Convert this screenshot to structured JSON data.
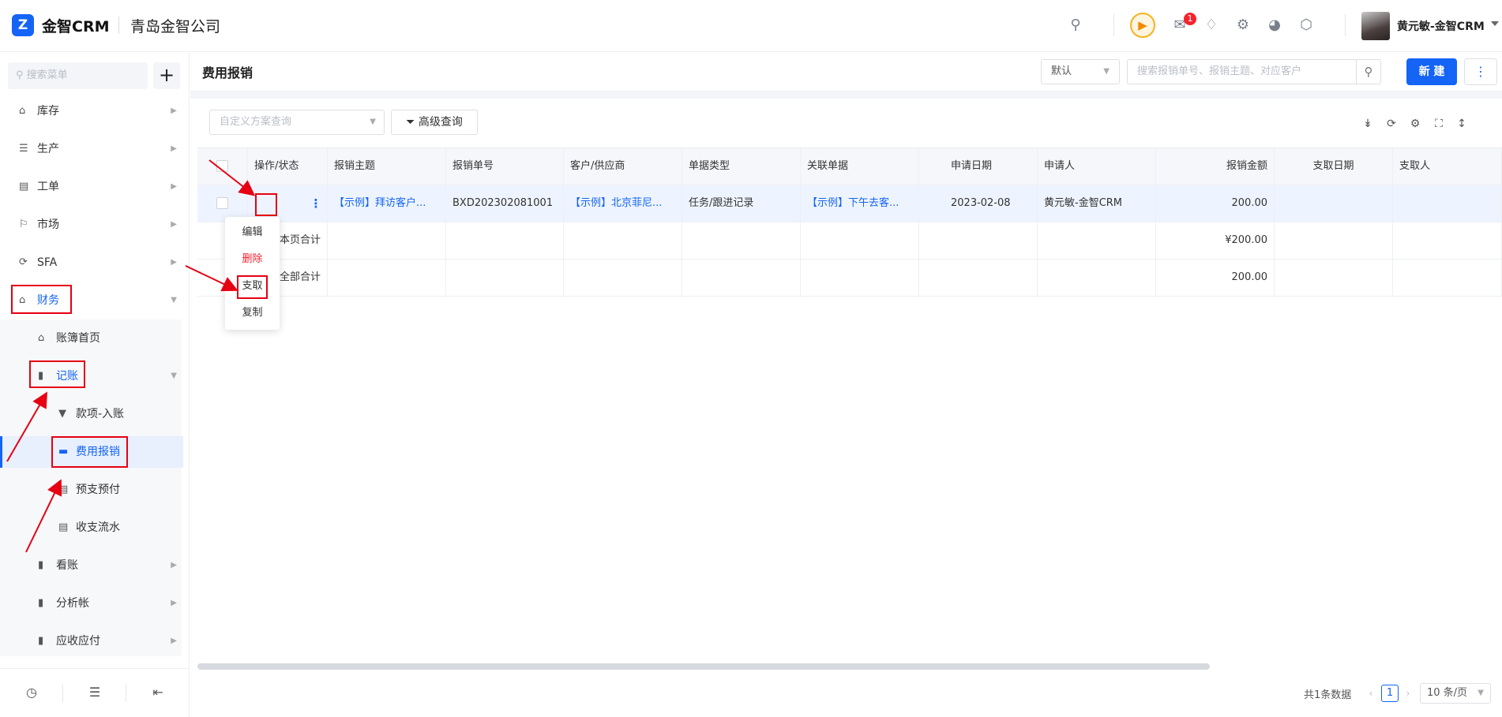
{
  "header": {
    "logo_glyph": "Z",
    "app_name": "金智CRM",
    "company": "青岛金智公司",
    "notification_count": "1",
    "user_name": "黄元敏-金智CRM"
  },
  "sidebar": {
    "search_placeholder": "搜索菜单",
    "add_label": "+",
    "items": [
      {
        "label": "库存",
        "icon": "warehouse-icon"
      },
      {
        "label": "生产",
        "icon": "production-icon"
      },
      {
        "label": "工单",
        "icon": "work-order-icon"
      },
      {
        "label": "市场",
        "icon": "market-icon"
      },
      {
        "label": "SFA",
        "icon": "sfa-icon"
      },
      {
        "label": "财务",
        "icon": "finance-icon"
      }
    ],
    "finance_children": [
      {
        "label": "账簿首页",
        "icon": "home-icon"
      },
      {
        "label": "记账",
        "icon": "folder-icon"
      }
    ],
    "bookkeeping_children": [
      {
        "label": "款项-入账",
        "icon": "receipt-icon"
      },
      {
        "label": "费用报销",
        "icon": "card-icon"
      },
      {
        "label": "预支预付",
        "icon": "prepay-icon"
      },
      {
        "label": "收支流水",
        "icon": "ledger-icon"
      }
    ],
    "more_children": [
      {
        "label": "看账",
        "icon": "folder-icon"
      },
      {
        "label": "分析帐",
        "icon": "folder-icon"
      },
      {
        "label": "应收应付",
        "icon": "folder-icon"
      }
    ]
  },
  "main": {
    "title": "费用报销",
    "scheme_select": "默认",
    "search_placeholder": "搜索报销单号、报销主题、对应客户",
    "new_button": "新 建",
    "custom_query_placeholder": "自定义方案查询",
    "advanced_query": "高级查询"
  },
  "table": {
    "columns": [
      "操作/状态",
      "报销主题",
      "报销单号",
      "客户/供应商",
      "单据类型",
      "关联单据",
      "申请日期",
      "申请人",
      "报销金额",
      "支取日期",
      "支取人"
    ],
    "row": {
      "subject": "【示例】拜访客户...",
      "number": "BXD202302081001",
      "customer": "【示例】北京菲尼...",
      "doc_type": "任务/跟进记录",
      "related": "【示例】下午去客...",
      "date": "2023-02-08",
      "applicant": "黄元敏-金智CRM",
      "amount": "200.00"
    },
    "page_total_label": "本页合计",
    "page_total_amount": "¥200.00",
    "all_total_label": "全部合计",
    "all_total_amount": "200.00"
  },
  "row_menu": {
    "edit": "编辑",
    "delete": "删除",
    "withdraw": "支取",
    "copy": "复制"
  },
  "pager": {
    "total": "共1条数据",
    "current": "1",
    "page_size": "10 条/页"
  },
  "colors": {
    "primary": "#1464f6",
    "annotation": "#e60012",
    "danger": "#f5222d"
  }
}
